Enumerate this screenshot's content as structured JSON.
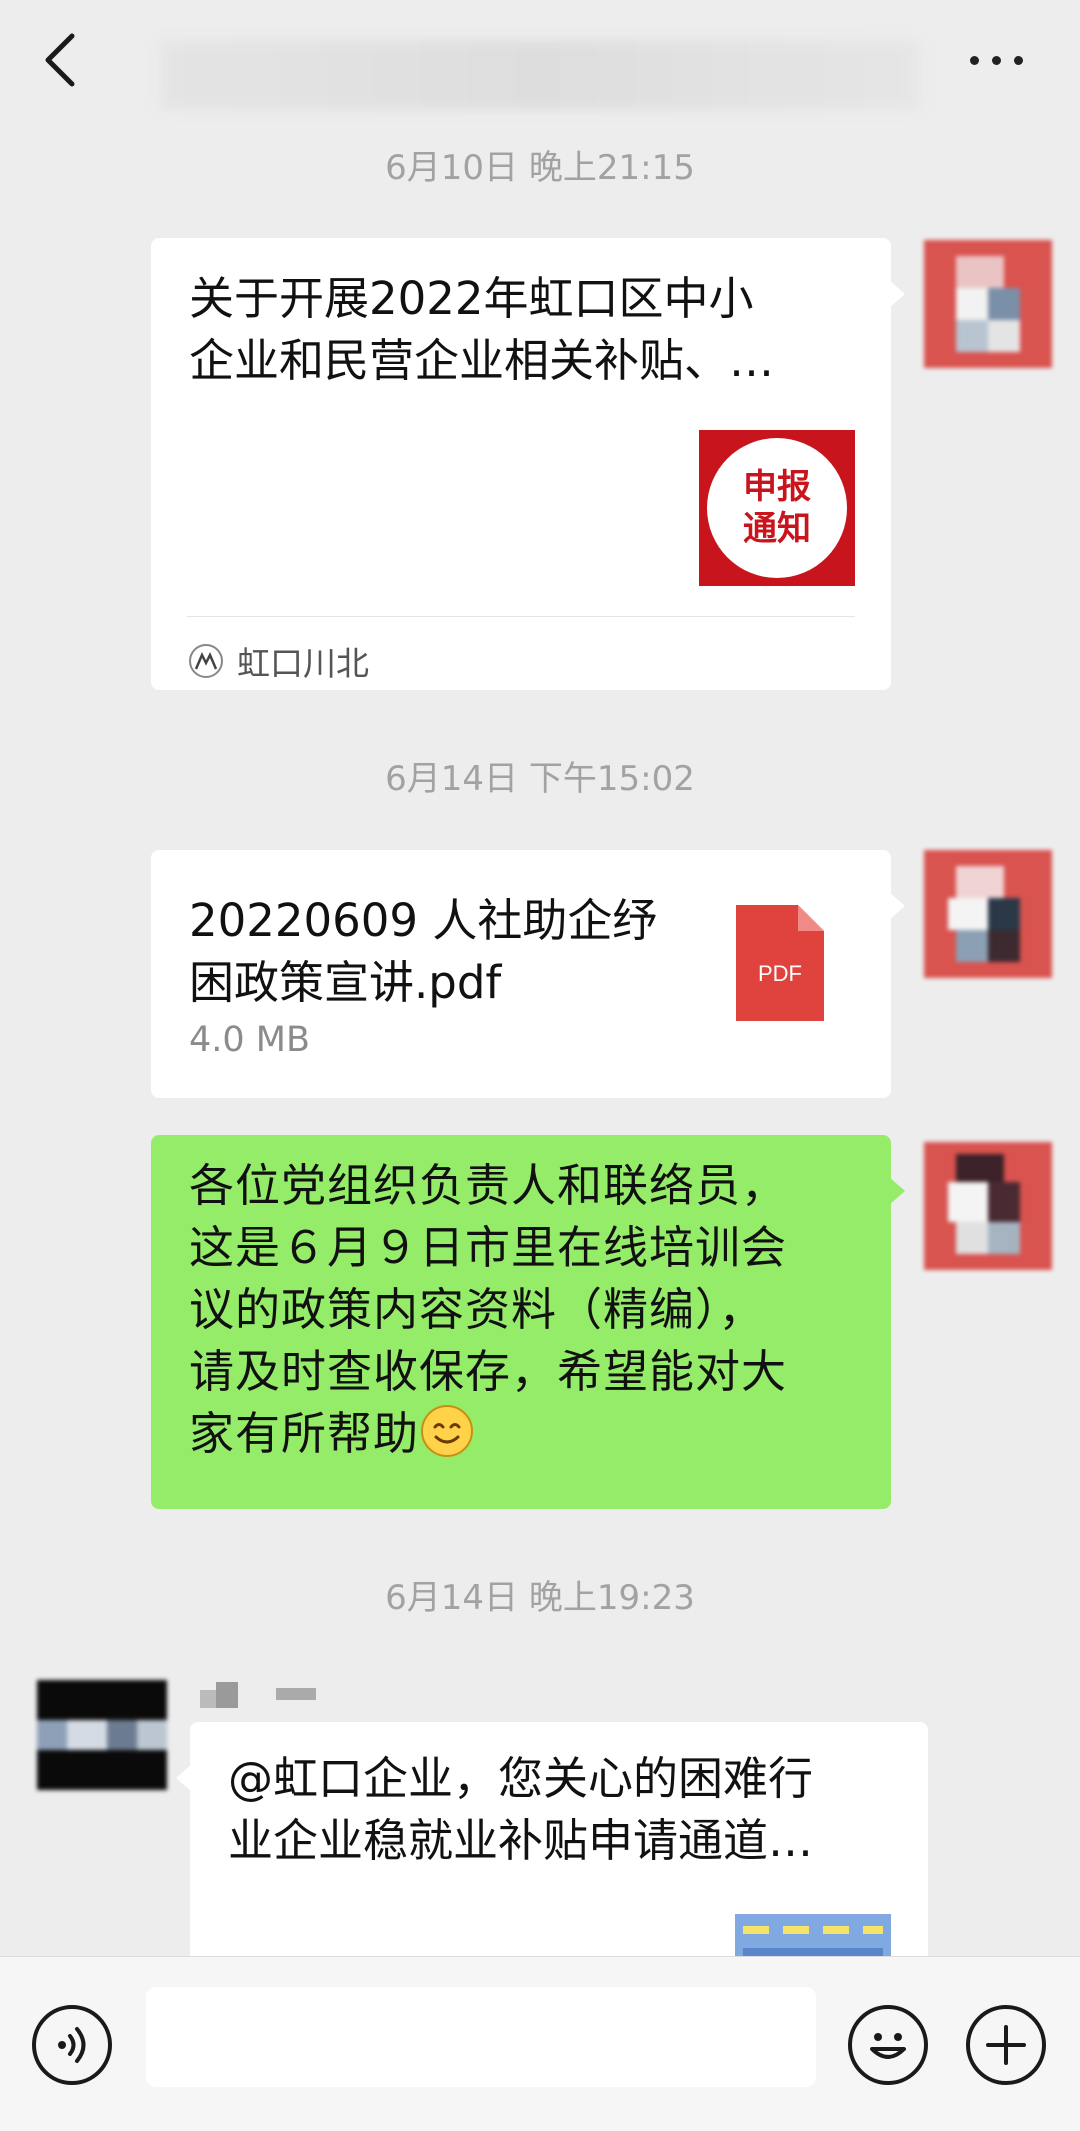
{
  "colors": {
    "background": "#ededed",
    "bubble_white": "#ffffff",
    "bubble_green": "#95ec69",
    "timestamp": "#a2a2a2",
    "thumb_red": "#c8151d",
    "pdf_red": "#e0433e"
  },
  "header": {
    "back_icon": "chevron-left-icon",
    "more_icon": "ellipsis-icon"
  },
  "messages": [
    {
      "timestamp": "6月10日 晚上21:15",
      "type": "article",
      "title_line1": "关于开展2022年虹口区中小",
      "title_line2": "企业和民营企业相关补贴、…",
      "thumb_line1": "申报",
      "thumb_line2": "通知",
      "source": "虹口川北"
    },
    {
      "timestamp": "6月14日 下午15:02",
      "type": "file",
      "name_line1": "20220609 人社助企纾",
      "name_line2": "困政策宣讲.pdf",
      "size": "4.0 MB",
      "icon_label": "PDF"
    },
    {
      "type": "text",
      "lines": [
        "各位党组织负责人和联络员，",
        "这是６月９日市里在线培训会",
        "议的政策内容资料（精编），",
        "请及时查收保存，希望能对大",
        "家有所帮助"
      ],
      "emoji": "smiley-icon"
    },
    {
      "timestamp": "6月14日 晚上19:23",
      "type": "article_incoming",
      "title_line1": "@虹口企业，您关心的困难行",
      "title_line2": "业企业稳就业补贴申请通道…"
    }
  ],
  "input_bar": {
    "voice_icon": "voice-icon",
    "emoji_icon": "emoji-icon",
    "add_icon": "plus-icon"
  }
}
